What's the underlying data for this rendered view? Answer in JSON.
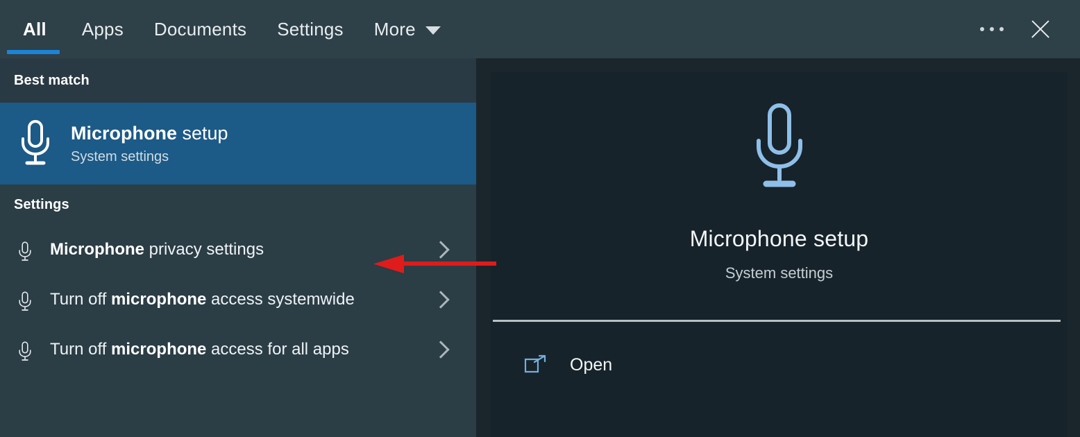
{
  "window": {
    "title": "Windows Search",
    "accent_color": "#1b84d8",
    "highlight_color": "#1c5a87",
    "panel_color": "#2b3d45",
    "card_color": "#17232a",
    "annotation_color": "#e01b1b"
  },
  "topbar": {
    "tabs": [
      {
        "label": "All",
        "active": true
      },
      {
        "label": "Apps",
        "active": false
      },
      {
        "label": "Documents",
        "active": false
      },
      {
        "label": "Settings",
        "active": false
      },
      {
        "label": "More",
        "active": false,
        "has_caret": true
      }
    ],
    "more_caret_icon": "chevron-down-icon",
    "overflow_icon": "ellipsis-icon",
    "close_icon": "close-icon"
  },
  "results": {
    "best_match_heading": "Best match",
    "best_match": {
      "icon": "microphone-icon",
      "title_bold": "Microphone",
      "title_rest": " setup",
      "subtitle": "System settings"
    },
    "settings_heading": "Settings",
    "settings_items": [
      {
        "icon": "microphone-icon",
        "parts": [
          {
            "text": "Microphone",
            "bold": true
          },
          {
            "text": " privacy settings",
            "bold": false
          }
        ],
        "chevron_icon": "chevron-right-icon"
      },
      {
        "icon": "microphone-icon",
        "parts": [
          {
            "text": "Turn off ",
            "bold": false
          },
          {
            "text": "microphone",
            "bold": true
          },
          {
            "text": " access systemwide",
            "bold": false
          }
        ],
        "chevron_icon": "chevron-right-icon"
      },
      {
        "icon": "microphone-icon",
        "parts": [
          {
            "text": "Turn off ",
            "bold": false
          },
          {
            "text": "microphone",
            "bold": true
          },
          {
            "text": " access for all apps",
            "bold": false
          }
        ],
        "chevron_icon": "chevron-right-icon"
      }
    ]
  },
  "preview": {
    "hero_icon": "microphone-icon",
    "title": "Microphone setup",
    "subtitle": "System settings",
    "actions": [
      {
        "icon": "open-external-icon",
        "label": "Open"
      }
    ]
  },
  "annotation": {
    "type": "arrow",
    "direction": "left",
    "color": "#e01b1b",
    "points_to": "Microphone privacy settings"
  }
}
